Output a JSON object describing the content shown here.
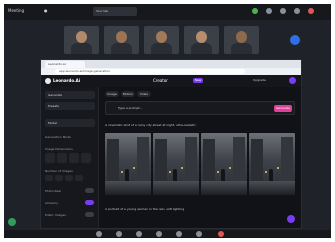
{
  "meeting": {
    "title": "Meeting",
    "tab": "Your tab",
    "participants": [
      "",
      "",
      "",
      "",
      ""
    ]
  },
  "browser": {
    "tab_title": "Leonardo.ai",
    "url": "app.leonardo.ai/image-generation"
  },
  "app": {
    "brand": "Leonardo.Ai",
    "create_tab": "Creator",
    "new_badge": "New",
    "account": "Upgrade"
  },
  "left_panel": {
    "items": [
      "Generate",
      "Presets",
      "Model"
    ],
    "labels": [
      "Generation Mode",
      "Image Dimensions",
      "Number of Images",
      "Photo Real",
      "Alchemy",
      "Public Images"
    ]
  },
  "main": {
    "filters": [
      "Image",
      "Motion",
      "Video"
    ],
    "prompt": "Type a prompt...",
    "generate": "Generate",
    "caption_1": "A cinematic shot of a rainy city street at night, ultra-realistic",
    "caption_2": "A portrait of a young woman in the rain, soft lighting"
  },
  "colors": {
    "accent": "#e0409a",
    "purple": "#7a3cf0",
    "meeting_blue": "#2f6fe4",
    "bg": "#1f2228"
  },
  "icons": [
    "mic-icon",
    "camera-icon",
    "share-icon",
    "chat-icon",
    "people-icon",
    "more-icon",
    "leave-icon"
  ]
}
